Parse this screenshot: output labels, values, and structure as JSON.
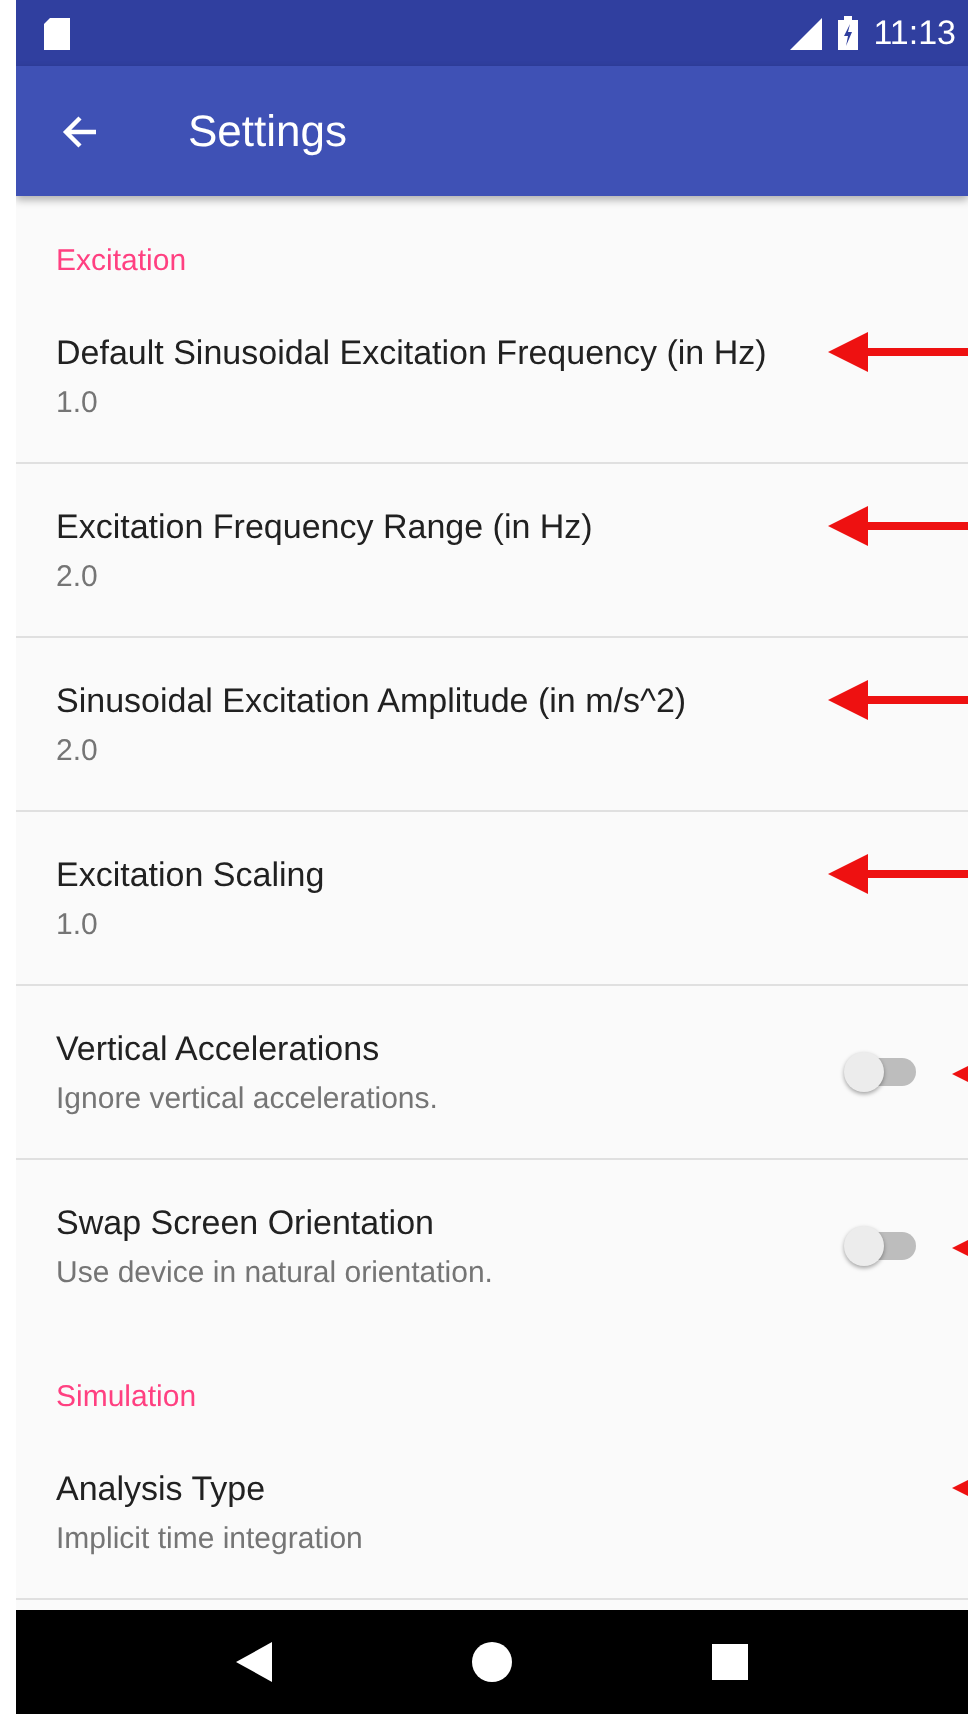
{
  "status_bar": {
    "time": "11:13"
  },
  "toolbar": {
    "title": "Settings"
  },
  "sections": [
    {
      "header": "Excitation",
      "items": [
        {
          "kind": "text",
          "title": "Default Sinusoidal Excitation Frequency (in Hz)",
          "summary": "1.0",
          "annotated": true,
          "arrow_clipped": false
        },
        {
          "kind": "text",
          "title": "Excitation Frequency Range (in Hz)",
          "summary": "2.0",
          "annotated": true,
          "arrow_clipped": false
        },
        {
          "kind": "text",
          "title": "Sinusoidal Excitation Amplitude (in m/s^2)",
          "summary": "2.0",
          "annotated": true,
          "arrow_clipped": false
        },
        {
          "kind": "text",
          "title": "Excitation Scaling",
          "summary": "1.0",
          "annotated": true,
          "arrow_clipped": false
        },
        {
          "kind": "switch",
          "title": "Vertical Accelerations",
          "summary": "Ignore vertical accelerations.",
          "on": false,
          "annotated": true,
          "arrow_clipped": true
        },
        {
          "kind": "switch",
          "title": "Swap Screen Orientation",
          "summary": "Use device in natural orientation.",
          "on": false,
          "annotated": true,
          "arrow_clipped": true
        }
      ]
    },
    {
      "header": "Simulation",
      "items": [
        {
          "kind": "text",
          "title": "Analysis Type",
          "summary": "Implicit time integration",
          "annotated": true,
          "arrow_clipped": true
        }
      ]
    }
  ]
}
